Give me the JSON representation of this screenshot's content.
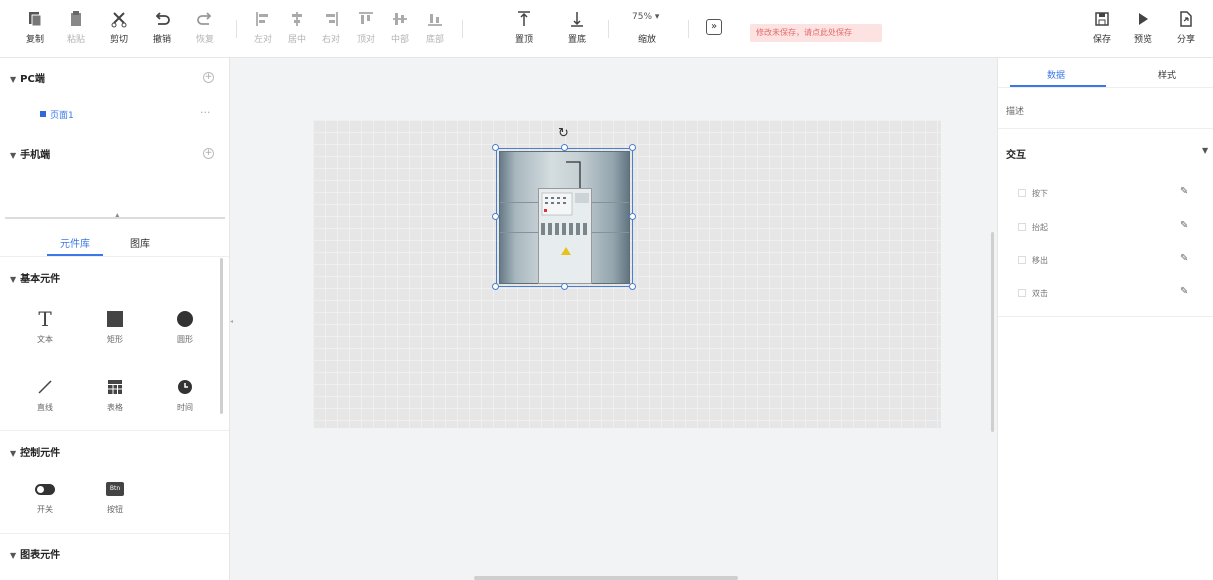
{
  "toolbar": {
    "buttons": [
      {
        "label": "复制",
        "icon": "copy-icon",
        "disabled": false
      },
      {
        "label": "粘贴",
        "icon": "paste-icon",
        "disabled": true
      },
      {
        "label": "剪切",
        "icon": "cut-icon",
        "disabled": false
      },
      {
        "label": "撤销",
        "icon": "undo-icon",
        "disabled": false
      },
      {
        "label": "恢复",
        "icon": "redo-icon",
        "disabled": true
      },
      {
        "label": "左对",
        "icon": "align-left-icon",
        "disabled": true
      },
      {
        "label": "居中",
        "icon": "align-center-icon",
        "disabled": true
      },
      {
        "label": "右对",
        "icon": "align-right-icon",
        "disabled": true
      },
      {
        "label": "顶对",
        "icon": "align-top-icon",
        "disabled": true
      },
      {
        "label": "中部",
        "icon": "align-middle-icon",
        "disabled": true
      },
      {
        "label": "底部",
        "icon": "align-bottom-icon",
        "disabled": true
      },
      {
        "label": "置顶",
        "icon": "bring-front-icon",
        "disabled": false
      },
      {
        "label": "置底",
        "icon": "send-back-icon",
        "disabled": false
      }
    ],
    "zoom_value": "75% ▾",
    "zoom_label": "缩放",
    "unsaved_notice": "修改未保存，请点此处保存",
    "save_label": "保存",
    "preview_label": "预览",
    "share_label": "分享"
  },
  "left_panel": {
    "pc_section": "PC端",
    "pc_page": "页面1",
    "mobile_section": "手机端",
    "tabs": [
      "元件库",
      "图库"
    ],
    "groups": [
      {
        "title": "基本元件",
        "items": [
          {
            "label": "文本",
            "icon": "text-icon"
          },
          {
            "label": "矩形",
            "icon": "rectangle-icon"
          },
          {
            "label": "圆形",
            "icon": "circle-icon"
          },
          {
            "label": "直线",
            "icon": "line-icon"
          },
          {
            "label": "表格",
            "icon": "table-icon"
          },
          {
            "label": "时间",
            "icon": "clock-icon"
          }
        ]
      },
      {
        "title": "控制元件",
        "items": [
          {
            "label": "开关",
            "icon": "toggle-icon"
          },
          {
            "label": "按钮",
            "icon": "button-icon",
            "icon_text": "Btn"
          }
        ]
      },
      {
        "title": "图表元件",
        "items": []
      }
    ]
  },
  "right_panel": {
    "tabs": [
      "数据",
      "样式"
    ],
    "field_label": "描述",
    "section_title": "交互",
    "events": [
      "按下",
      "抬起",
      "移出",
      "双击"
    ]
  },
  "colors": {
    "accent": "#3b78e7",
    "warning_bg": "#fde2e2",
    "warning_text": "#e26a6a"
  }
}
